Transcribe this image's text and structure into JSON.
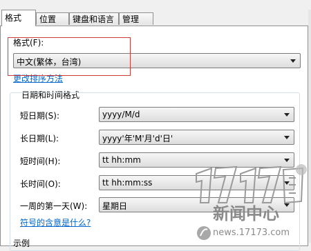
{
  "tabs": [
    "格式",
    "位置",
    "键盘和语言",
    "管理"
  ],
  "format": {
    "label": "格式(F):",
    "value": "中文(繁体，台湾)",
    "sort_link": "更改排序方法"
  },
  "datetime_group": {
    "title": "日期和时间格式",
    "rows": [
      {
        "label": "短日期(S):",
        "value": "yyyy/M/d"
      },
      {
        "label": "长日期(L):",
        "value": "yyyy'年'M'月'd'日'"
      },
      {
        "label": "短时间(H):",
        "value": "tt hh:mm"
      },
      {
        "label": "长时间(O):",
        "value": "tt hh:mm:ss"
      },
      {
        "label": "一周的第一天(W):",
        "value": "星期日"
      }
    ],
    "symbols_link": "符号的含意是什么?"
  },
  "example_label": "示例",
  "watermark": {
    "logo": "17173",
    "title": "新闻中心",
    "url": "news.17173.com"
  }
}
